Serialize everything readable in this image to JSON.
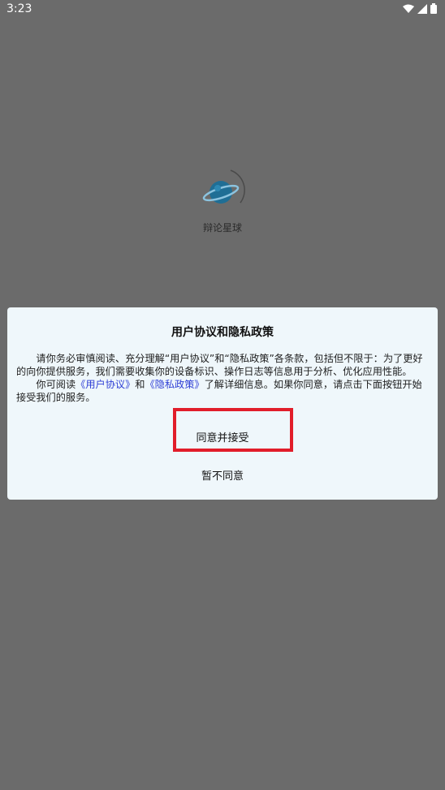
{
  "status_bar": {
    "time": "3:23",
    "icons": [
      "wifi-icon",
      "signal-icon",
      "battery-icon"
    ]
  },
  "splash": {
    "app_name": "辩论星球",
    "logo": "planet-logo"
  },
  "dialog": {
    "title": "用户协议和隐私政策",
    "para1": "请你务必审慎阅读、充分理解“用户协议”和“隐私政策”各条款，包括但不限于：为了更好的向你提供服务，我们需要收集你的设备标识、操作日志等信息用于分析、优化应用性能。",
    "para2_prefix": "你可阅读",
    "link_user_agreement": "《用户协议》",
    "para2_and": "和",
    "link_privacy_policy": "《隐私政策》",
    "para2_suffix": "了解详细信息。如果你同意，请点击下面按钮开始接受我们的服务。",
    "agree_label": "同意并接受",
    "decline_label": "暂不同意"
  },
  "colors": {
    "overlay": "#6b6b6b",
    "dialog_bg": "#eff7fb",
    "link": "#2f3fd6",
    "highlight": "#e11d2a"
  }
}
